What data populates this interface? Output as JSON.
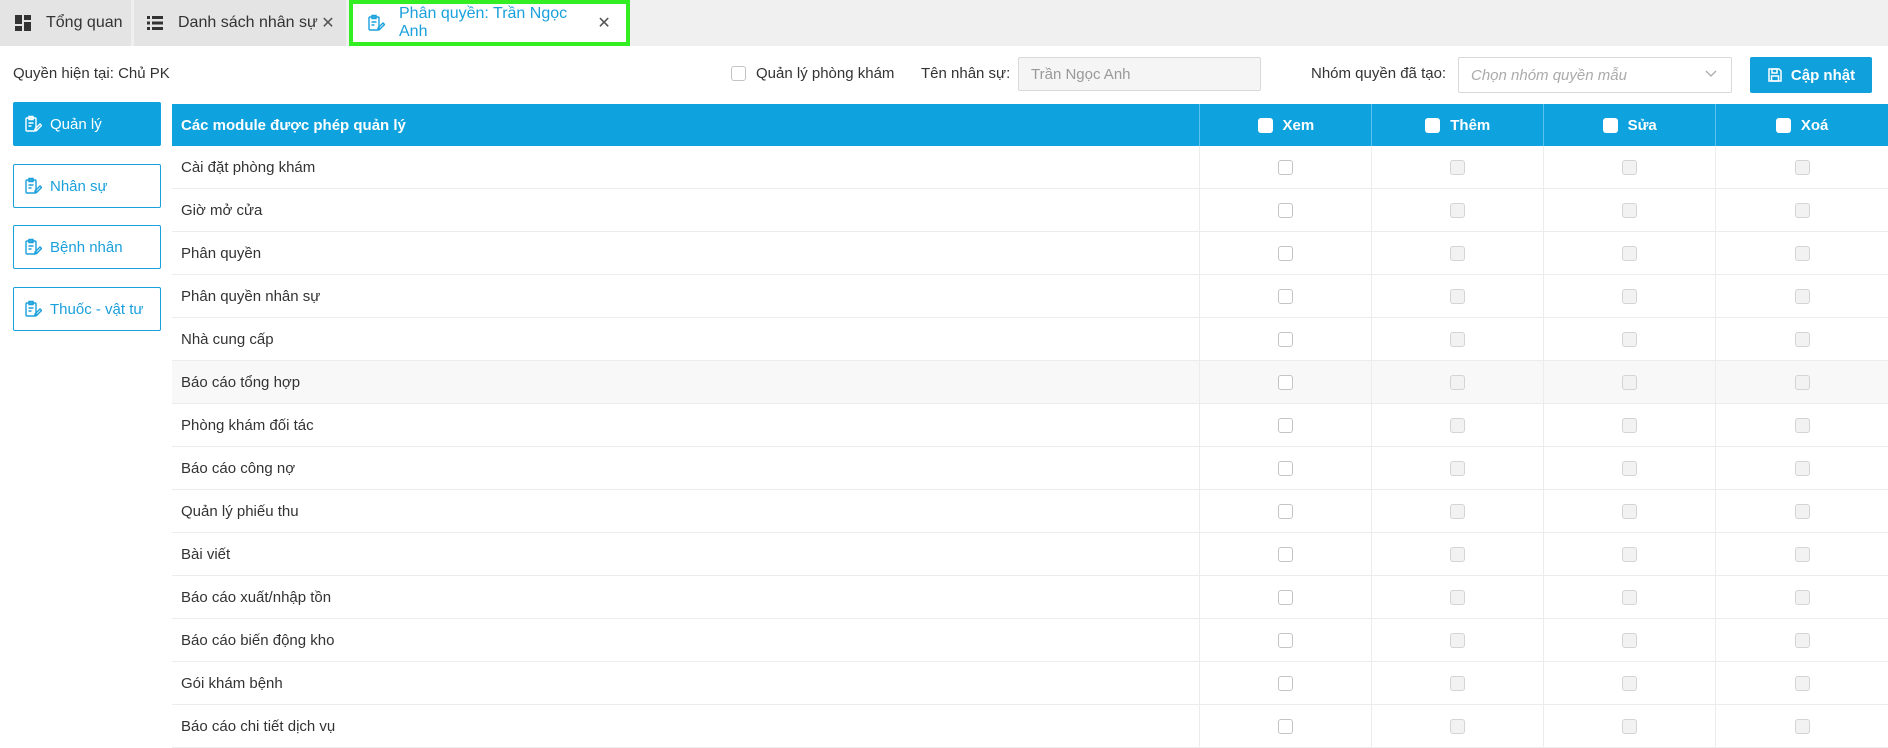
{
  "tabs": [
    {
      "label": "Tổng quan",
      "icon": "dashboard-icon",
      "closable": false
    },
    {
      "label": "Danh sách nhân sự",
      "icon": "list-icon",
      "closable": true
    },
    {
      "label": "Phân quyền: Trần Ngọc Anh",
      "icon": "edit-doc-icon",
      "closable": true,
      "active": true
    }
  ],
  "toolbar": {
    "current_permission": "Quyền hiện tại: Chủ PK",
    "clinic_manager_label": "Quản lý phòng khám",
    "staff_name_label": "Tên nhân sự:",
    "staff_name_value": "Trần Ngọc Anh",
    "group_label": "Nhóm quyền đã tạo:",
    "group_placeholder": "Chọn nhóm quyền mẫu",
    "update_label": "Cập nhật"
  },
  "sidebar": {
    "items": [
      {
        "label": "Quản lý",
        "active": true
      },
      {
        "label": "Nhân sự",
        "active": false
      },
      {
        "label": "Bệnh nhân",
        "active": false
      },
      {
        "label": "Thuốc - vật tư",
        "active": false
      }
    ]
  },
  "table": {
    "columns": [
      "Các module được phép quản lý",
      "Xem",
      "Thêm",
      "Sửa",
      "Xoá"
    ],
    "rows": [
      "Cài đặt phòng khám",
      "Giờ mở cửa",
      "Phân quyền",
      "Phân quyền nhân sự",
      "Nhà cung cấp",
      "Báo cáo tổng hợp",
      "Phòng khám đối tác",
      "Báo cáo công nợ",
      "Quản lý phiếu thu",
      "Bài viết",
      "Báo cáo xuất/nhập tồn",
      "Báo cáo biến động kho",
      "Gói khám bệnh",
      "Báo cáo chi tiết dịch vụ"
    ]
  },
  "colors": {
    "accent": "#0ea2de",
    "active_tab_outline": "#33ee22"
  }
}
